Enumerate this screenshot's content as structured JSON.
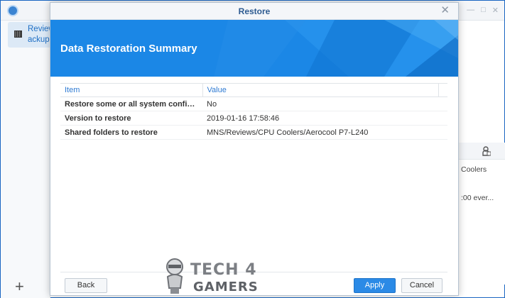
{
  "background_app": {
    "task_label_line1": "Review",
    "task_label_line2": "ackup",
    "add_label": "+",
    "right_text_1": "Coolers",
    "right_text_2": ":00 ever..."
  },
  "dialog": {
    "title": "Restore",
    "close_label": "✕",
    "banner_title": "Data Restoration Summary",
    "table": {
      "columns": [
        "Item",
        "Value"
      ],
      "rows": [
        {
          "item": "Restore some or all system configura...",
          "value": "No"
        },
        {
          "item": "Version to restore",
          "value": "2019-01-16 17:58:46"
        },
        {
          "item": "Shared folders to restore",
          "value": "MNS/Reviews/CPU Coolers/Aerocool P7-L240"
        }
      ]
    },
    "buttons": {
      "back": "Back",
      "apply": "Apply",
      "cancel": "Cancel"
    }
  },
  "watermark": {
    "line1": "TECH 4",
    "line2": "GAMERS"
  },
  "colors": {
    "accent": "#2b8ae6",
    "banner": "#1b87e6",
    "header_text": "#2f7bd3",
    "title_text": "#2d5b91"
  }
}
